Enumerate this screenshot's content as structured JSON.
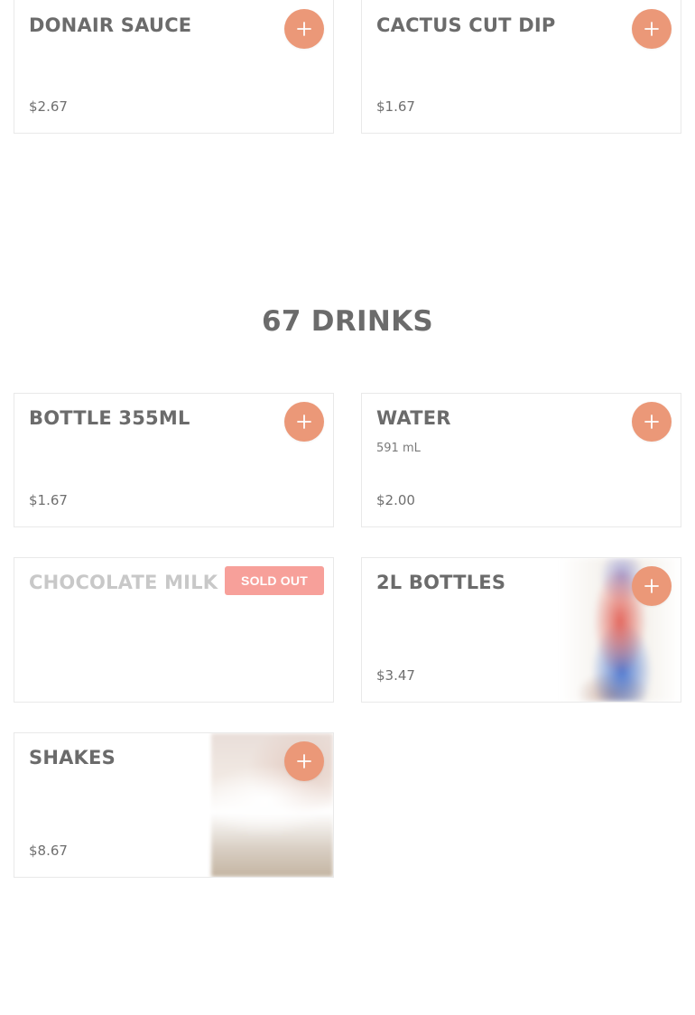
{
  "accent_color": "#eb9878",
  "sold_out_color": "#f7a09a",
  "top_items": [
    {
      "name": "DONAIR SAUCE",
      "price": "$2.67"
    },
    {
      "name": "CACTUS CUT DIP",
      "price": "$1.67"
    }
  ],
  "drinks_section": {
    "title": "67 DRINKS",
    "items": [
      {
        "name": "BOTTLE 355ML",
        "price": "$1.67"
      },
      {
        "name": "WATER",
        "description": "591 mL",
        "price": "$2.00"
      },
      {
        "name": "CHOCOLATE MILK",
        "badge": "SOLD OUT"
      },
      {
        "name": "2L BOTTLES",
        "price": "$3.47"
      },
      {
        "name": "SHAKES",
        "price": "$8.67"
      }
    ]
  },
  "icons": {
    "add": "plus-icon"
  }
}
